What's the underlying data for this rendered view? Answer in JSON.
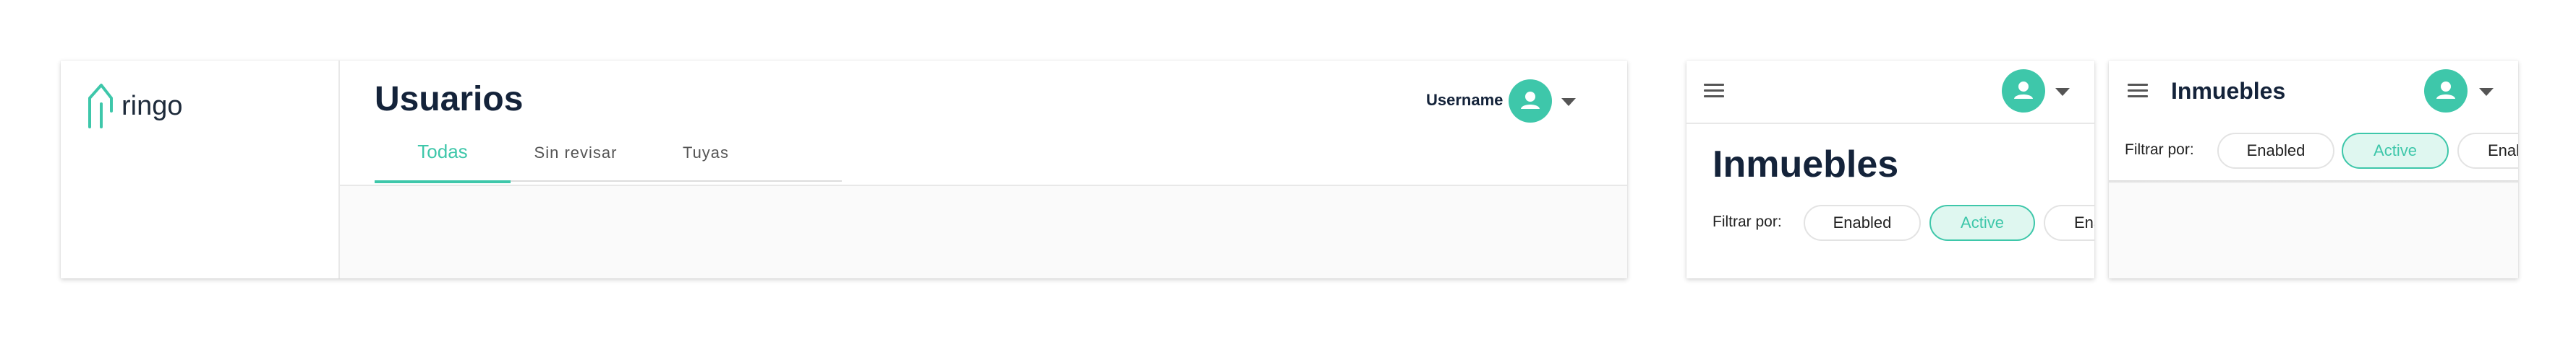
{
  "brand": {
    "logo_text": "ringo",
    "accent": "#3ec7aa"
  },
  "desktop": {
    "page_title": "Usuarios",
    "username": "Username",
    "tabs": [
      {
        "label": "Todas",
        "active": true
      },
      {
        "label": "Sin revisar",
        "active": false
      },
      {
        "label": "Tuyas",
        "active": false
      }
    ]
  },
  "mobile": {
    "page_title": "Inmuebles",
    "filter_label": "Filtrar por:",
    "chips": [
      {
        "label": "Enabled",
        "active": false
      },
      {
        "label": "Active",
        "active": true
      },
      {
        "label": "Ena",
        "active": false
      }
    ]
  },
  "mobile_compact": {
    "page_title": "Inmuebles",
    "filter_label": "Filtrar por:",
    "chips": [
      {
        "label": "Enabled",
        "active": false
      },
      {
        "label": "Active",
        "active": true
      },
      {
        "label": "Enal",
        "active": false
      }
    ]
  },
  "icons": {
    "logo": "house-icon",
    "menu": "hamburger-icon",
    "avatar": "person-icon",
    "dropdown": "caret-down-icon"
  }
}
